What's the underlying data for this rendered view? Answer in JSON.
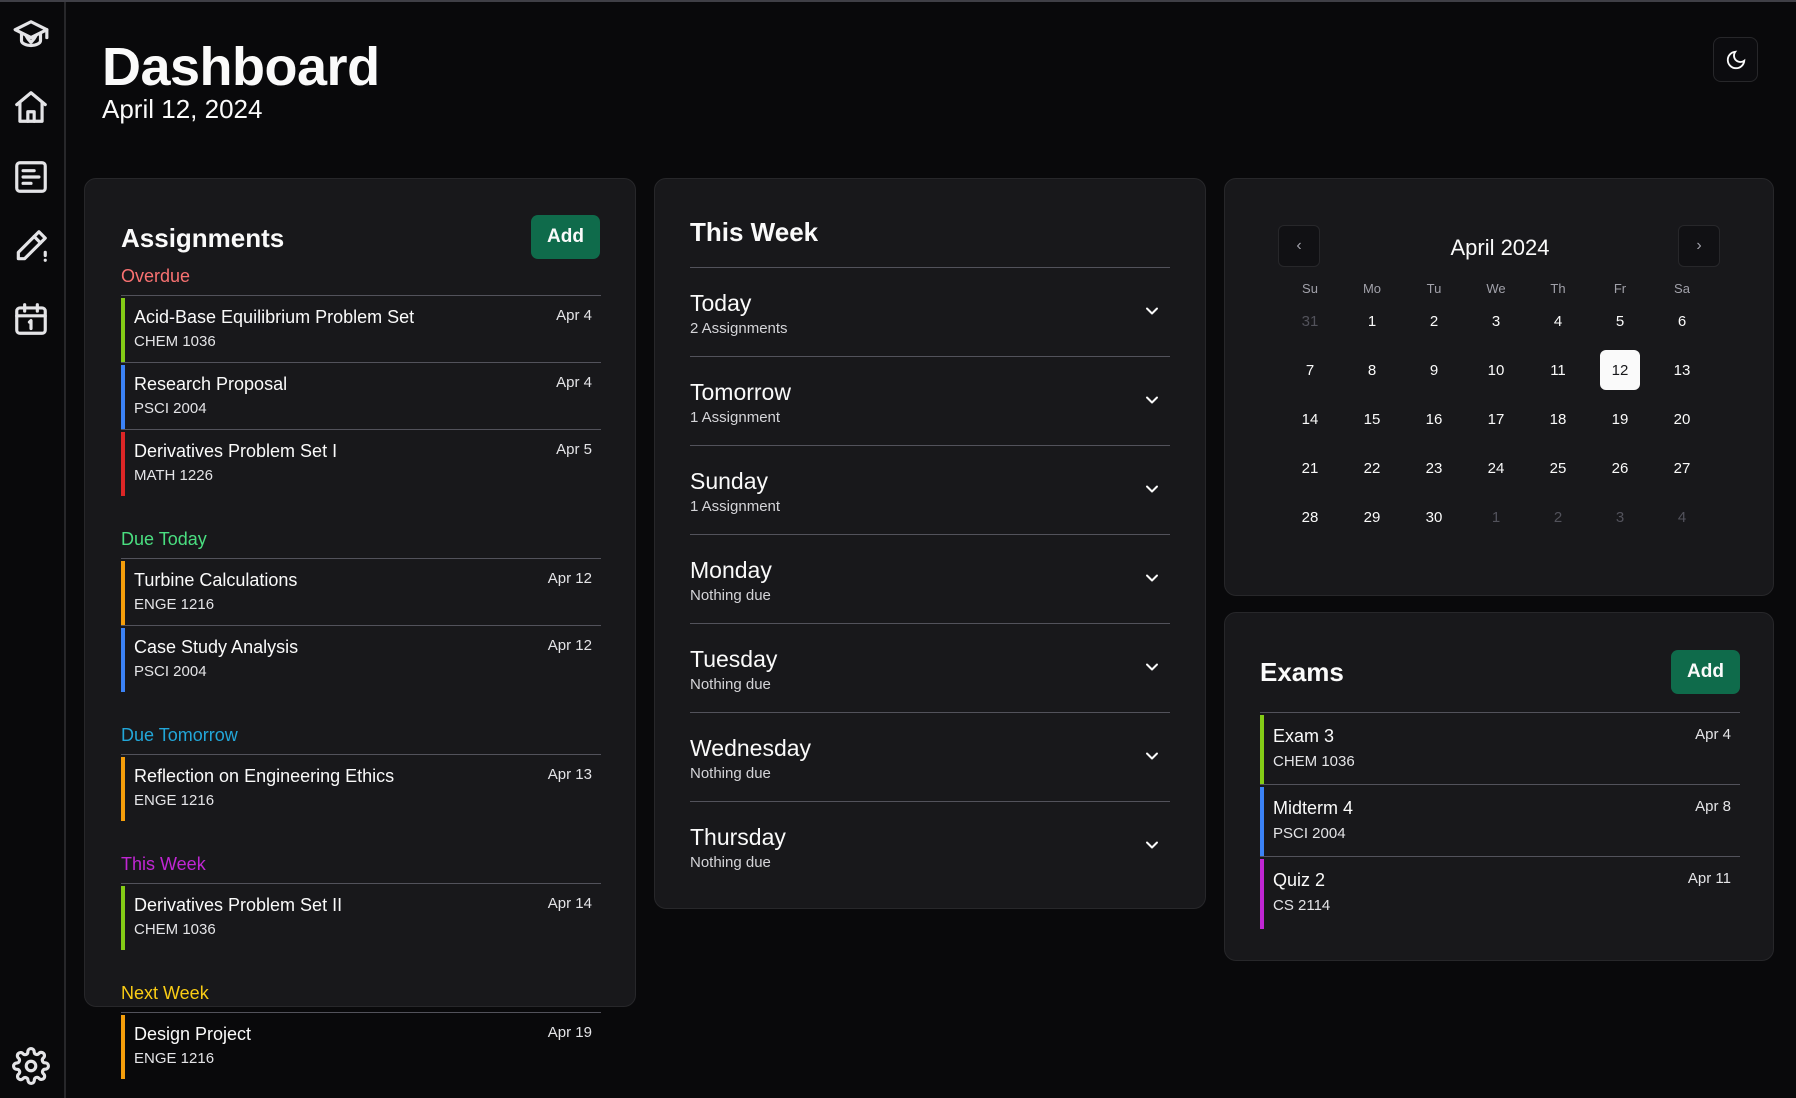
{
  "header": {
    "title": "Dashboard",
    "date": "April 12, 2024"
  },
  "sidebar": {
    "items": [
      {
        "name": "logo-icon"
      },
      {
        "name": "home-icon"
      },
      {
        "name": "document-icon"
      },
      {
        "name": "pencil-icon"
      },
      {
        "name": "calendar-icon"
      },
      {
        "name": "settings-icon"
      }
    ]
  },
  "theme_toggle": {
    "icon": "moon-icon"
  },
  "assignments": {
    "title": "Assignments",
    "add_label": "Add",
    "groups": [
      {
        "label": "Overdue",
        "color": "#f87171",
        "items": [
          {
            "name": "Acid-Base Equilibrium Problem Set",
            "course": "CHEM 1036",
            "due": "Apr 4",
            "color": "#84cc16"
          },
          {
            "name": "Research Proposal",
            "course": "PSCI 2004",
            "due": "Apr 4",
            "color": "#3b82f6"
          },
          {
            "name": "Derivatives Problem Set I",
            "course": "MATH 1226",
            "due": "Apr 5",
            "color": "#dc2626"
          }
        ]
      },
      {
        "label": "Due Today",
        "color": "#4ade80",
        "items": [
          {
            "name": "Turbine Calculations",
            "course": "ENGE 1216",
            "due": "Apr 12",
            "color": "#f59e0b"
          },
          {
            "name": "Case Study Analysis",
            "course": "PSCI 2004",
            "due": "Apr 12",
            "color": "#3b82f6"
          }
        ]
      },
      {
        "label": "Due Tomorrow",
        "color": "#22a6d8",
        "items": [
          {
            "name": "Reflection on Engineering Ethics",
            "course": "ENGE 1216",
            "due": "Apr 13",
            "color": "#f59e0b"
          }
        ]
      },
      {
        "label": "This Week",
        "color": "#c026d3",
        "items": [
          {
            "name": "Derivatives Problem Set II",
            "course": "CHEM 1036",
            "due": "Apr 14",
            "color": "#84cc16"
          }
        ]
      },
      {
        "label": "Next Week",
        "color": "#facc15",
        "items": [
          {
            "name": "Design Project",
            "course": "ENGE 1216",
            "due": "Apr 19",
            "color": "#f59e0b"
          }
        ]
      }
    ]
  },
  "this_week": {
    "title": "This Week",
    "days": [
      {
        "day": "Today",
        "summary": "2 Assignments"
      },
      {
        "day": "Tomorrow",
        "summary": "1 Assignment"
      },
      {
        "day": "Sunday",
        "summary": "1 Assignment"
      },
      {
        "day": "Monday",
        "summary": "Nothing due"
      },
      {
        "day": "Tuesday",
        "summary": "Nothing due"
      },
      {
        "day": "Wednesday",
        "summary": "Nothing due"
      },
      {
        "day": "Thursday",
        "summary": "Nothing due"
      }
    ]
  },
  "calendar": {
    "month_label": "April 2024",
    "prev_label": "‹",
    "next_label": "›",
    "weekdays": [
      "Su",
      "Mo",
      "Tu",
      "We",
      "Th",
      "Fr",
      "Sa"
    ],
    "weeks": [
      [
        "31",
        "1",
        "2",
        "3",
        "4",
        "5",
        "6"
      ],
      [
        "7",
        "8",
        "9",
        "10",
        "11",
        "12",
        "13"
      ],
      [
        "14",
        "15",
        "16",
        "17",
        "18",
        "19",
        "20"
      ],
      [
        "21",
        "22",
        "23",
        "24",
        "25",
        "26",
        "27"
      ],
      [
        "28",
        "29",
        "30",
        "1",
        "2",
        "3",
        "4"
      ]
    ],
    "outside_days": [
      [
        0,
        0
      ],
      [
        4,
        3
      ],
      [
        4,
        4
      ],
      [
        4,
        5
      ],
      [
        4,
        6
      ]
    ],
    "selected": [
      1,
      5
    ]
  },
  "exams": {
    "title": "Exams",
    "add_label": "Add",
    "items": [
      {
        "name": "Exam 3",
        "course": "CHEM 1036",
        "due": "Apr 4",
        "color": "#84cc16"
      },
      {
        "name": "Midterm 4",
        "course": "PSCI 2004",
        "due": "Apr 8",
        "color": "#3b82f6"
      },
      {
        "name": "Quiz 2",
        "course": "CS 2114",
        "due": "Apr 11",
        "color": "#c026d3"
      }
    ]
  }
}
